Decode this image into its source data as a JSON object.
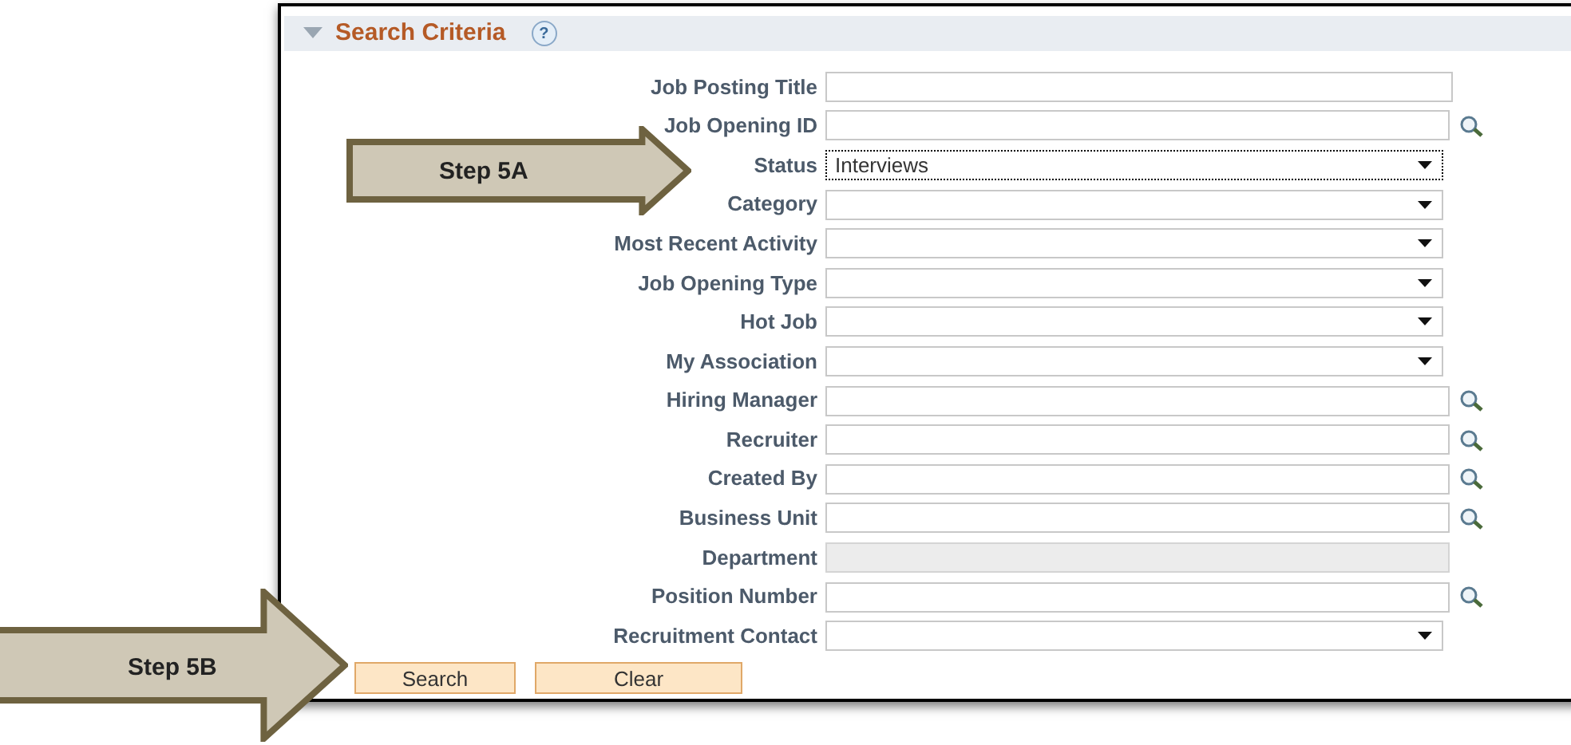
{
  "section": {
    "title": "Search Criteria",
    "expanded": true,
    "help": "?"
  },
  "fields": [
    {
      "label": "Job Posting Title",
      "kind": "text"
    },
    {
      "label": "Job Opening ID",
      "kind": "lookup"
    },
    {
      "label": "Status",
      "kind": "dropdown",
      "value": "Interviews",
      "focused": true
    },
    {
      "label": "Category",
      "kind": "dropdown",
      "focused": false
    },
    {
      "label": "Most Recent Activity",
      "kind": "dropdown",
      "focused": false
    },
    {
      "label": "Job Opening Type",
      "kind": "dropdown",
      "focused": false
    },
    {
      "label": "Hot Job",
      "kind": "dropdown",
      "focused": false
    },
    {
      "label": "My Association",
      "kind": "dropdown",
      "focused": false
    },
    {
      "label": "Hiring Manager",
      "kind": "lookup"
    },
    {
      "label": "Recruiter",
      "kind": "lookup"
    },
    {
      "label": "Created By",
      "kind": "lookup"
    },
    {
      "label": "Business Unit",
      "kind": "lookup"
    },
    {
      "label": "Department",
      "kind": "disabled"
    },
    {
      "label": "Position Number",
      "kind": "lookup"
    },
    {
      "label": "Recruitment Contact",
      "kind": "dropdown",
      "focused": false
    }
  ],
  "buttons": [
    "Search",
    "Clear"
  ],
  "callouts": [
    {
      "text": "Step 5A"
    },
    {
      "text": "Step 5B"
    }
  ]
}
